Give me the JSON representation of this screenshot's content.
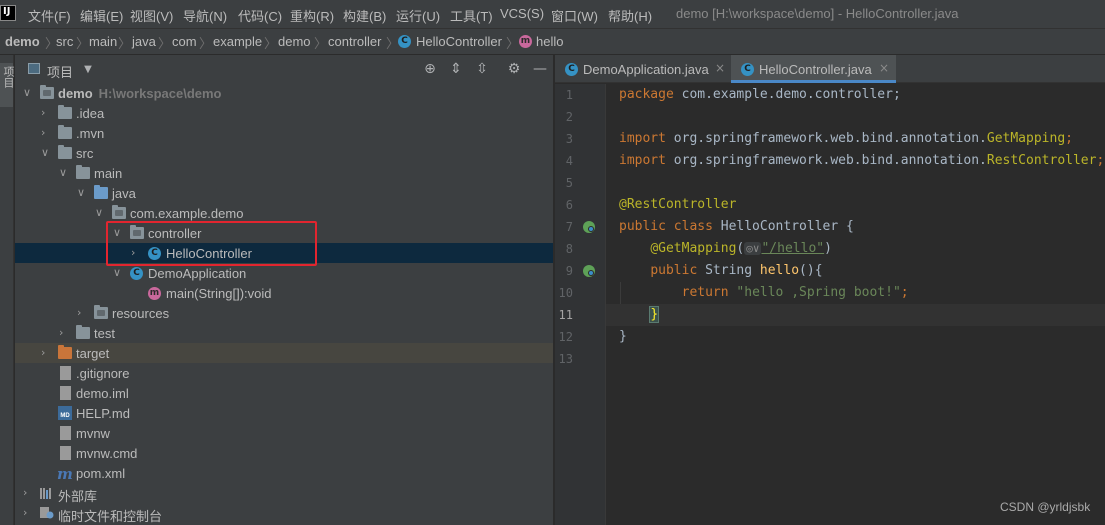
{
  "menubar": {
    "items": [
      "文件(F)",
      "编辑(E)",
      "视图(V)",
      "导航(N)",
      "代码(C)",
      "重构(R)",
      "构建(B)",
      "运行(U)",
      "工具(T)",
      "VCS(S)",
      "窗口(W)",
      "帮助(H)"
    ],
    "window_title": "demo [H:\\workspace\\demo] - HelloController.java"
  },
  "breadcrumb": [
    "demo",
    "src",
    "main",
    "java",
    "com",
    "example",
    "demo",
    "controller",
    "HelloController",
    "hello"
  ],
  "left_stripe": {
    "tab_label": "项目"
  },
  "project_panel": {
    "title": "项目",
    "tree": [
      {
        "label": "demo",
        "path": "H:\\workspace\\demo",
        "icon": "module-folder-icon",
        "expanded": true
      },
      {
        "label": ".idea",
        "icon": "folder-icon",
        "expanded": false
      },
      {
        "label": ".mvn",
        "icon": "folder-icon",
        "expanded": false
      },
      {
        "label": "src",
        "icon": "folder-icon",
        "expanded": true
      },
      {
        "label": "main",
        "icon": "folder-icon",
        "expanded": true
      },
      {
        "label": "java",
        "icon": "source-folder-icon",
        "expanded": true
      },
      {
        "label": "com.example.demo",
        "icon": "package-icon",
        "expanded": true
      },
      {
        "label": "controller",
        "icon": "package-icon",
        "expanded": true
      },
      {
        "label": "HelloController",
        "icon": "class-icon",
        "expanded": false,
        "selected": true
      },
      {
        "label": "DemoApplication",
        "icon": "spring-class-icon",
        "expanded": true
      },
      {
        "label": "main(String[]):void",
        "icon": "method-icon"
      },
      {
        "label": "resources",
        "icon": "resources-folder-icon",
        "expanded": false
      },
      {
        "label": "test",
        "icon": "folder-icon",
        "expanded": false
      },
      {
        "label": "target",
        "icon": "excluded-folder-icon",
        "expanded": false,
        "highlighted": true
      },
      {
        "label": ".gitignore",
        "icon": "text-file-icon"
      },
      {
        "label": "demo.iml",
        "icon": "iml-file-icon"
      },
      {
        "label": "HELP.md",
        "icon": "markdown-file-icon"
      },
      {
        "label": "mvnw",
        "icon": "script-file-icon"
      },
      {
        "label": "mvnw.cmd",
        "icon": "script-file-icon"
      },
      {
        "label": "pom.xml",
        "icon": "maven-icon"
      },
      {
        "label": "外部库",
        "icon": "libraries-icon",
        "expanded": false
      },
      {
        "label": "临时文件和控制台",
        "icon": "scratches-icon",
        "expanded": false
      }
    ]
  },
  "editor": {
    "tabs": [
      {
        "label": "DemoApplication.java",
        "active": false
      },
      {
        "label": "HelloController.java",
        "active": true
      }
    ],
    "current_line": 11,
    "line_numbers": [
      "1",
      "2",
      "3",
      "4",
      "5",
      "6",
      "7",
      "8",
      "9",
      "10",
      "11",
      "12",
      "13"
    ],
    "lines": {
      "l1_kw": "package",
      "l1_rest": " com.example.demo.controller;",
      "l3_kw": "import",
      "l3_rest": " org.springframework.web.bind.annotation.",
      "l3_cls": "GetMapping",
      "l3_end": ";",
      "l4_kw": "import",
      "l4_rest": " org.springframework.web.bind.annotation.",
      "l4_cls": "RestController",
      "l4_end": ";",
      "l6_ann": "@RestController",
      "l7_kw": "public class",
      "l7_rest": " HelloController {",
      "l8_ann": "@GetMapping",
      "l8_paren": "(",
      "l8_hint": "◎∨",
      "l8_str": "\"/hello\"",
      "l8_end": ")",
      "l9_kw": "public",
      "l9_type": " String ",
      "l9_fn": "hello",
      "l9_end": "(){",
      "l10_kw": "return",
      "l10_str": " \"hello ,Spring boot!\"",
      "l10_end": ";",
      "l11_brace": "}",
      "l12": "}"
    }
  },
  "watermark": "CSDN @yrldjsbk"
}
